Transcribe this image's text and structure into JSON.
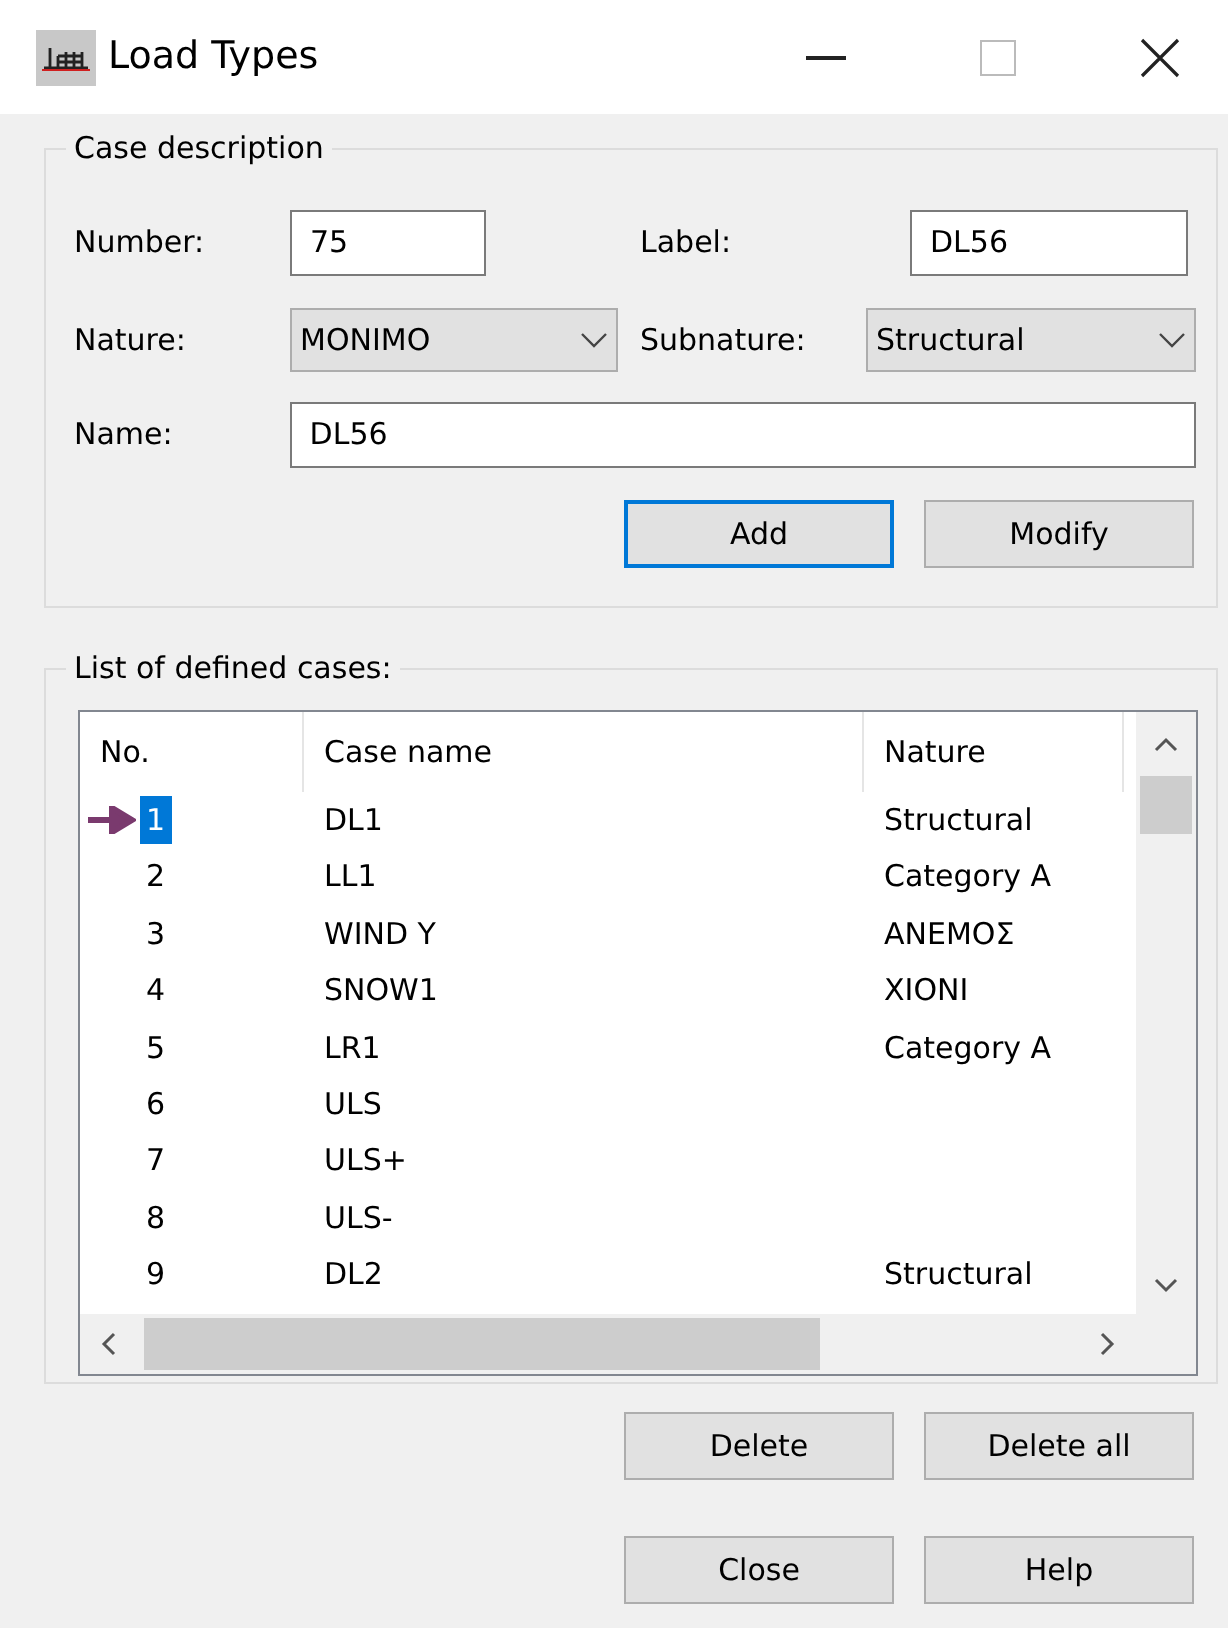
{
  "window": {
    "title": "Load Types"
  },
  "case_description": {
    "title": "Case description",
    "number": {
      "label": "Number:",
      "value": "75"
    },
    "label": {
      "label": "Label:",
      "value": "DL56"
    },
    "nature": {
      "label": "Nature:",
      "value": "MONIMO"
    },
    "subnature": {
      "label": "Subnature:",
      "value": "Structural"
    },
    "name": {
      "label": "Name:",
      "value": "DL56"
    },
    "buttons": [
      {
        "label": "Add",
        "default": true
      },
      {
        "label": "Modify",
        "default": false
      }
    ]
  },
  "cases": {
    "title": "List of defined cases:",
    "columns": [
      "No.",
      "Case name",
      "Nature"
    ],
    "rows": [
      {
        "no": "1",
        "name": "DL1",
        "nature": "Structural",
        "selected": true
      },
      {
        "no": "2",
        "name": "LL1",
        "nature": "Category A",
        "selected": false
      },
      {
        "no": "3",
        "name": "WIND Y",
        "nature": "ΑΝΕΜΟΣ",
        "selected": false
      },
      {
        "no": "4",
        "name": "SNOW1",
        "nature": "ΧΙΟΝΙ",
        "selected": false
      },
      {
        "no": "5",
        "name": "LR1",
        "nature": "Category A",
        "selected": false
      },
      {
        "no": "6",
        "name": "ULS",
        "selected": false
      },
      {
        "no": "7",
        "name": "ULS+",
        "selected": false
      },
      {
        "no": "8",
        "name": "ULS-",
        "selected": false
      },
      {
        "no": "9",
        "name": "DL2",
        "nature": "Structural",
        "selected": false
      }
    ],
    "buttons": [
      {
        "label": "Delete"
      },
      {
        "label": "Delete all"
      }
    ]
  },
  "footer_buttons": [
    {
      "label": "Close"
    },
    {
      "label": "Help"
    }
  ]
}
